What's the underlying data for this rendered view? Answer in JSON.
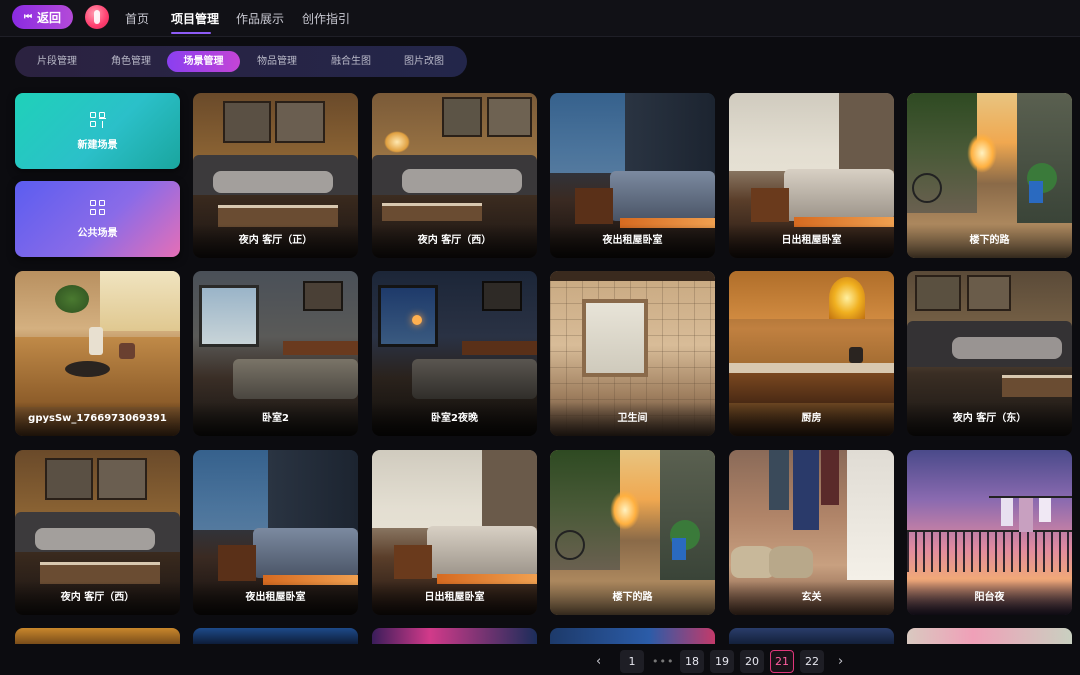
{
  "topbar": {
    "back_label": "返回",
    "nav": [
      {
        "label": "首页"
      },
      {
        "label": "项目管理",
        "active": true
      },
      {
        "label": "作品展示"
      },
      {
        "label": "创作指引"
      }
    ]
  },
  "subtabs": [
    {
      "label": "片段管理"
    },
    {
      "label": "角色管理"
    },
    {
      "label": "场景管理",
      "active": true
    },
    {
      "label": "物品管理"
    },
    {
      "label": "融合生图"
    },
    {
      "label": "图片改图"
    }
  ],
  "actions": {
    "new_scene": "新建场景",
    "public_scene": "公共场景"
  },
  "scenes": [
    {
      "title": "夜内 客厅（正）",
      "palette": "livingroom"
    },
    {
      "title": "夜内 客厅（西）",
      "palette": "livingroom2"
    },
    {
      "title": "夜出租屋卧室",
      "palette": "bedroom_night"
    },
    {
      "title": "日出租屋卧室",
      "palette": "bedroom_day"
    },
    {
      "title": "楼下的路",
      "palette": "alley"
    },
    {
      "title": "gpysSw_1766973069391",
      "palette": "table"
    },
    {
      "title": "卧室2",
      "palette": "bedroom2"
    },
    {
      "title": "卧室2夜晚",
      "palette": "bedroom2_night"
    },
    {
      "title": "卫生间",
      "palette": "bathroom"
    },
    {
      "title": "厨房",
      "palette": "kitchen"
    },
    {
      "title": "夜内 客厅（东）",
      "palette": "livingroom3"
    },
    {
      "title": "夜内 客厅（西）",
      "palette": "livingroom"
    },
    {
      "title": "夜出租屋卧室",
      "palette": "bedroom_night"
    },
    {
      "title": "日出租屋卧室",
      "palette": "bedroom_day"
    },
    {
      "title": "楼下的路",
      "palette": "alley"
    },
    {
      "title": "玄关",
      "palette": "entry"
    },
    {
      "title": "阳台夜",
      "palette": "balcony"
    }
  ],
  "pagination": {
    "prev": "‹",
    "first": "1",
    "ellipsis": "•••",
    "pages": [
      "18",
      "19",
      "20",
      "21",
      "22"
    ],
    "current": "21",
    "next": "›"
  }
}
